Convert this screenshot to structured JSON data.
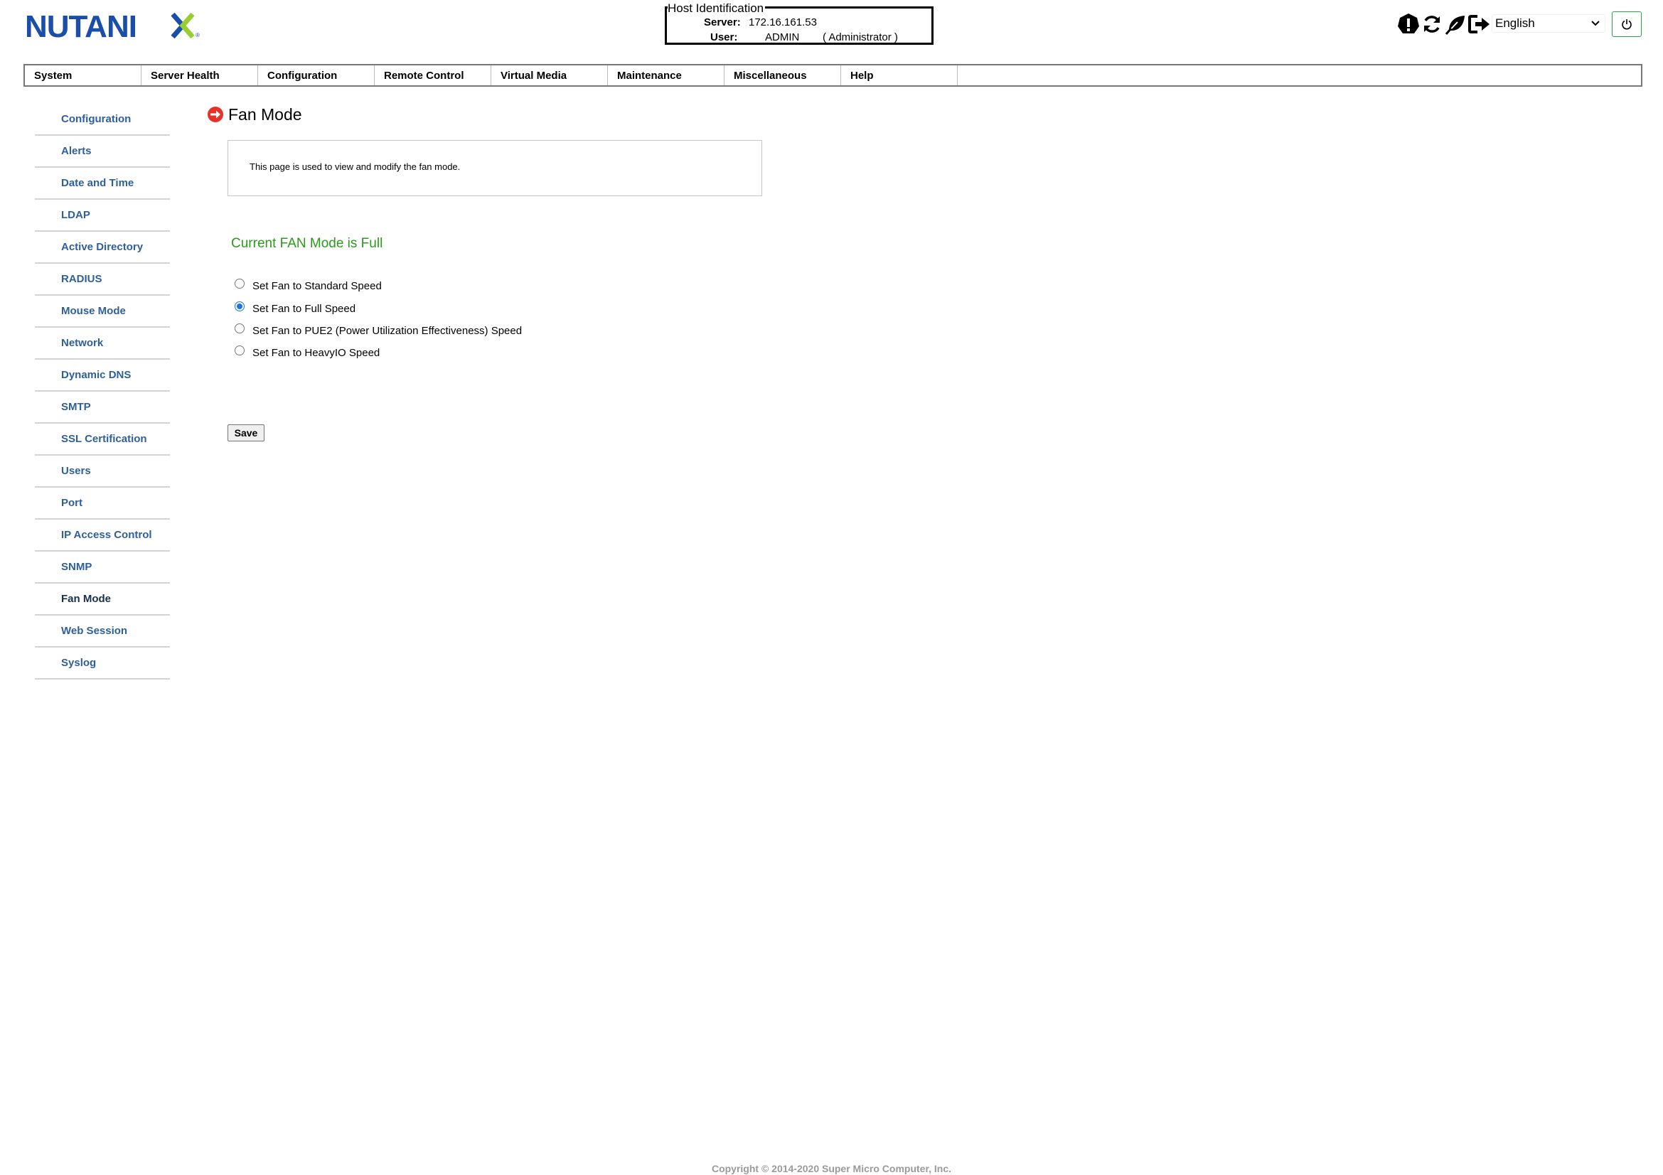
{
  "brand": {
    "logo_text": "NUTANIX",
    "logo_color": "#1a4ea8",
    "x_color": "#9acd32"
  },
  "host": {
    "legend": "Host Identification",
    "server_label": "Server:",
    "server_value": "172.16.161.53",
    "user_label": "User:",
    "user_value": "ADMIN",
    "user_role": "( Administrator )"
  },
  "toolbar": {
    "icons": [
      "alert-icon",
      "refresh-icon",
      "leaf-icon",
      "logout-icon",
      "power-icon"
    ],
    "language": "English"
  },
  "topnav": {
    "items": [
      "System",
      "Server Health",
      "Configuration",
      "Remote Control",
      "Virtual Media",
      "Maintenance",
      "Miscellaneous",
      "Help"
    ]
  },
  "sidebar": {
    "items": [
      {
        "label": "Configuration",
        "active": false
      },
      {
        "label": "Alerts",
        "active": false
      },
      {
        "label": "Date and Time",
        "active": false
      },
      {
        "label": "LDAP",
        "active": false
      },
      {
        "label": "Active Directory",
        "active": false
      },
      {
        "label": "RADIUS",
        "active": false
      },
      {
        "label": "Mouse Mode",
        "active": false
      },
      {
        "label": "Network",
        "active": false
      },
      {
        "label": "Dynamic DNS",
        "active": false
      },
      {
        "label": "SMTP",
        "active": false
      },
      {
        "label": "SSL Certification",
        "active": false
      },
      {
        "label": "Users",
        "active": false
      },
      {
        "label": "Port",
        "active": false
      },
      {
        "label": "IP Access Control",
        "active": false
      },
      {
        "label": "SNMP",
        "active": false
      },
      {
        "label": "Fan Mode",
        "active": true
      },
      {
        "label": "Web Session",
        "active": false
      },
      {
        "label": "Syslog",
        "active": false
      }
    ]
  },
  "main": {
    "title": "Fan Mode",
    "description": "This page is used to view and modify the fan mode.",
    "status": "Current FAN Mode is Full",
    "status_color": "#2a9a1a",
    "options": [
      {
        "label": "Set Fan to Standard Speed",
        "checked": false
      },
      {
        "label": "Set Fan to Full Speed",
        "checked": true
      },
      {
        "label": "Set Fan to PUE2 (Power Utilization Effectiveness) Speed",
        "checked": false
      },
      {
        "label": "Set Fan to HeavyIO Speed",
        "checked": false
      }
    ],
    "save_label": "Save"
  },
  "footer": {
    "copyright": "Copyright © 2014-2020 Super Micro Computer, Inc."
  }
}
